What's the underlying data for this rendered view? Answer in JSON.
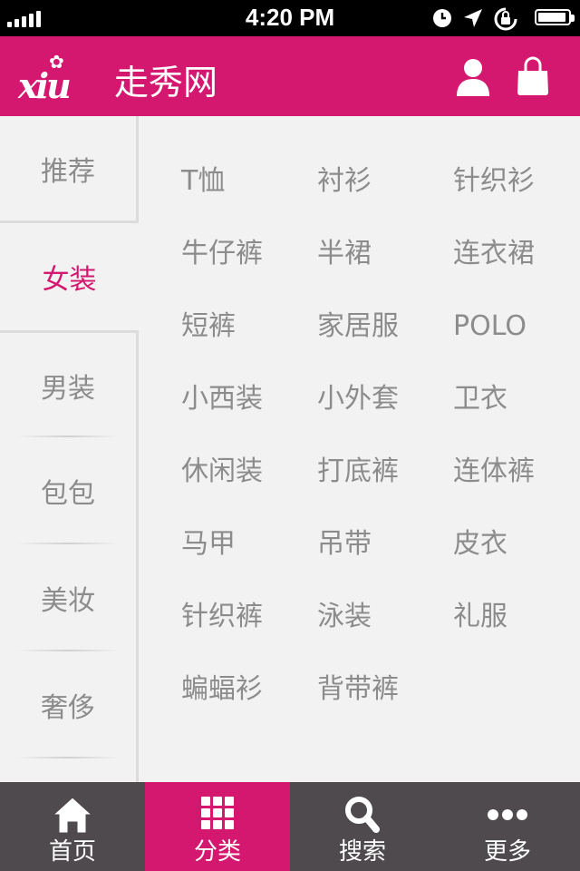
{
  "status_bar": {
    "time": "4:20 PM",
    "battery_level": 0.95
  },
  "header": {
    "logo_text": "xiu",
    "site_name": "走秀网"
  },
  "sidebar": {
    "items": [
      {
        "label": "推荐"
      },
      {
        "label": "女装",
        "active": true
      },
      {
        "label": "男装"
      },
      {
        "label": "包包"
      },
      {
        "label": "美妆"
      },
      {
        "label": "奢侈"
      }
    ]
  },
  "categories": [
    "T恤",
    "衬衫",
    "针织衫",
    "牛仔裤",
    "半裙",
    "连衣裙",
    "短裤",
    "家居服",
    "POLO",
    "小西装",
    "小外套",
    "卫衣",
    "休闲装",
    "打底裤",
    "连体裤",
    "马甲",
    "吊带",
    "皮衣",
    "针织裤",
    "泳装",
    "礼服",
    "蝙蝠衫",
    "背带裤"
  ],
  "tabbar": {
    "items": [
      {
        "label": "首页",
        "icon": "home-icon"
      },
      {
        "label": "分类",
        "icon": "grid-icon",
        "active": true
      },
      {
        "label": "搜索",
        "icon": "search-icon"
      },
      {
        "label": "更多",
        "icon": "more-icon"
      }
    ]
  },
  "colors": {
    "brand": "#d4186f",
    "tabbar": "#4e4a4d",
    "text": "#8c8c8c"
  }
}
